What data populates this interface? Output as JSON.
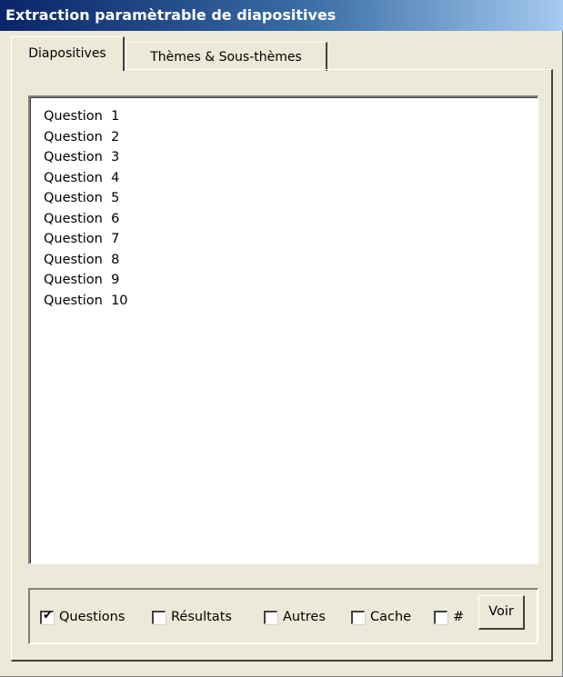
{
  "window": {
    "title": "Extraction paramètrable de diapositives"
  },
  "tabs": [
    {
      "label": "Diapositives",
      "active": true
    },
    {
      "label": "Thèmes & Sous-thèmes",
      "active": false
    }
  ],
  "slide_list": {
    "items": [
      "Question  1",
      "Question  2",
      "Question  3",
      "Question  4",
      "Question  5",
      "Question  6",
      "Question  7",
      "Question  8",
      "Question  9",
      "Question  10"
    ]
  },
  "options": [
    {
      "label": "Questions",
      "checked": true
    },
    {
      "label": "Résultats",
      "checked": false
    },
    {
      "label": "Autres",
      "checked": false
    },
    {
      "label": "Cache",
      "checked": false
    },
    {
      "label": "#",
      "checked": false
    }
  ],
  "actions": {
    "view_label": "Voir"
  },
  "colors": {
    "title_start": "#0a246a",
    "title_end": "#a6caf0",
    "face": "#ece9d8"
  }
}
